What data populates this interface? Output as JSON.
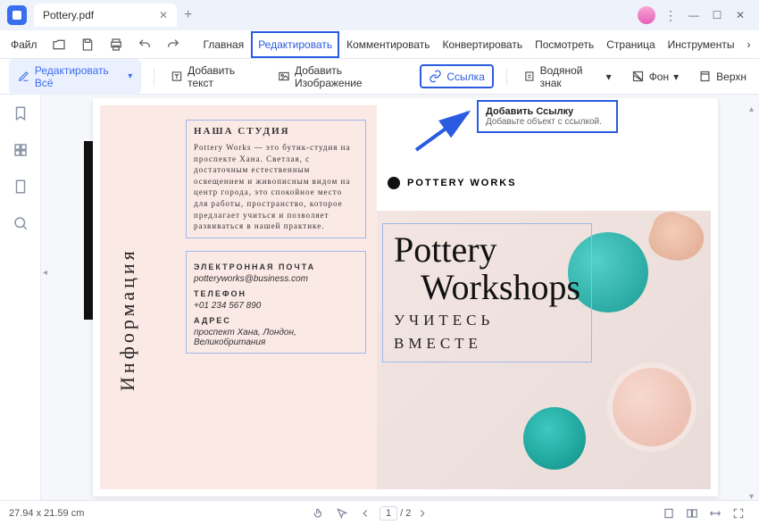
{
  "window": {
    "tab_title": "Pottery.pdf"
  },
  "menubar": {
    "file": "Файл",
    "tabs": [
      "Главная",
      "Редактировать",
      "Комментировать",
      "Конвертировать",
      "Посмотреть",
      "Страница",
      "Инструменты"
    ]
  },
  "toolbar": {
    "edit_all": "Редактировать Всё",
    "add_text": "Добавить текст",
    "add_image": "Добавить Изображение",
    "link": "Ссылка",
    "watermark": "Водяной знак",
    "background": "Фон",
    "header": "Верхн"
  },
  "tooltip": {
    "title": "Добавить Ссылку",
    "body": "Добавьте объект с ссылкой."
  },
  "doc": {
    "side_label": "Информация",
    "studio_h": "НАША СТУДИЯ",
    "studio_body": "Pottery Works — это бутик-студия на проспекте Хана. Светлая, с достаточным естественным освещением и живописным видом на центр города, это спокойное место для работы, пространство, которое предлагает учиться и позволяет развиваться в нашей практике.",
    "email_h": "ЭЛЕКТРОННАЯ ПОЧТА",
    "email_v": "potteryworks@business.com",
    "phone_h": "ТЕЛЕФОН",
    "phone_v": "+01 234 567 890",
    "addr_h": "АДРЕС",
    "addr_v": "проспект Хана, Лондон, Великобритания",
    "brand": "POTTERY WORKS",
    "headline1": "Pottery",
    "headline2": "Workshops",
    "sub1": "УЧИТЕСЬ",
    "sub2": "ВМЕСТЕ"
  },
  "status": {
    "dims": "27.94 x 21.59 cm",
    "page_cur": "1",
    "page_sep": "/",
    "page_total": "2"
  }
}
